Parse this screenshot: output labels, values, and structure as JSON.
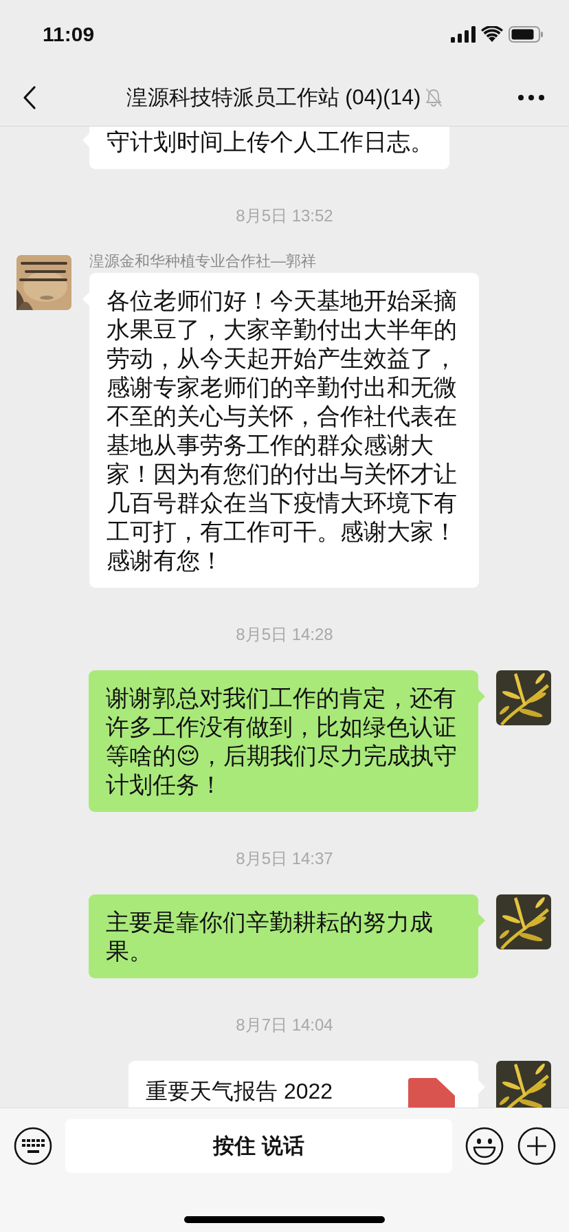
{
  "status_bar": {
    "time": "11:09"
  },
  "nav": {
    "title": "湟源科技特派员工作站 (04)(14)",
    "muted": true
  },
  "messages": [
    {
      "kind": "text",
      "outgoing": false,
      "text": "守计划时间上传个人工作日志。"
    },
    {
      "kind": "time",
      "text": "8月5日 13:52"
    },
    {
      "kind": "text",
      "outgoing": false,
      "sender": "湟源金和华种植专业合作社—郭祥",
      "text": "各位老师们好！今天基地开始采摘水果豆了，大家辛勤付出大半年的劳动，从今天起开始产生效益了，感谢专家老师们的辛勤付出和无微不至的关心与关怀，合作社代表在基地从事劳务工作的群众感谢大家！因为有您们的付出与关怀才让几百号群众在当下疫情大环境下有工可打，有工作可干。感谢大家！感谢有您！"
    },
    {
      "kind": "time",
      "text": "8月5日 14:28"
    },
    {
      "kind": "text",
      "outgoing": true,
      "text": "谢谢郭总对我们工作的肯定，还有许多工作没有做到，比如绿色认证等啥的😌，后期我们尽力完成执守计划任务！"
    },
    {
      "kind": "time",
      "text": "8月5日 14:37"
    },
    {
      "kind": "text",
      "outgoing": true,
      "text": "主要是靠你们辛勤耕耘的努力成果。"
    },
    {
      "kind": "time",
      "text": "8月7日 14:04"
    },
    {
      "kind": "file",
      "outgoing": true,
      "file_name": "重要天气报告 2022"
    }
  ],
  "input_bar": {
    "press_to_talk": "按住 说话"
  }
}
